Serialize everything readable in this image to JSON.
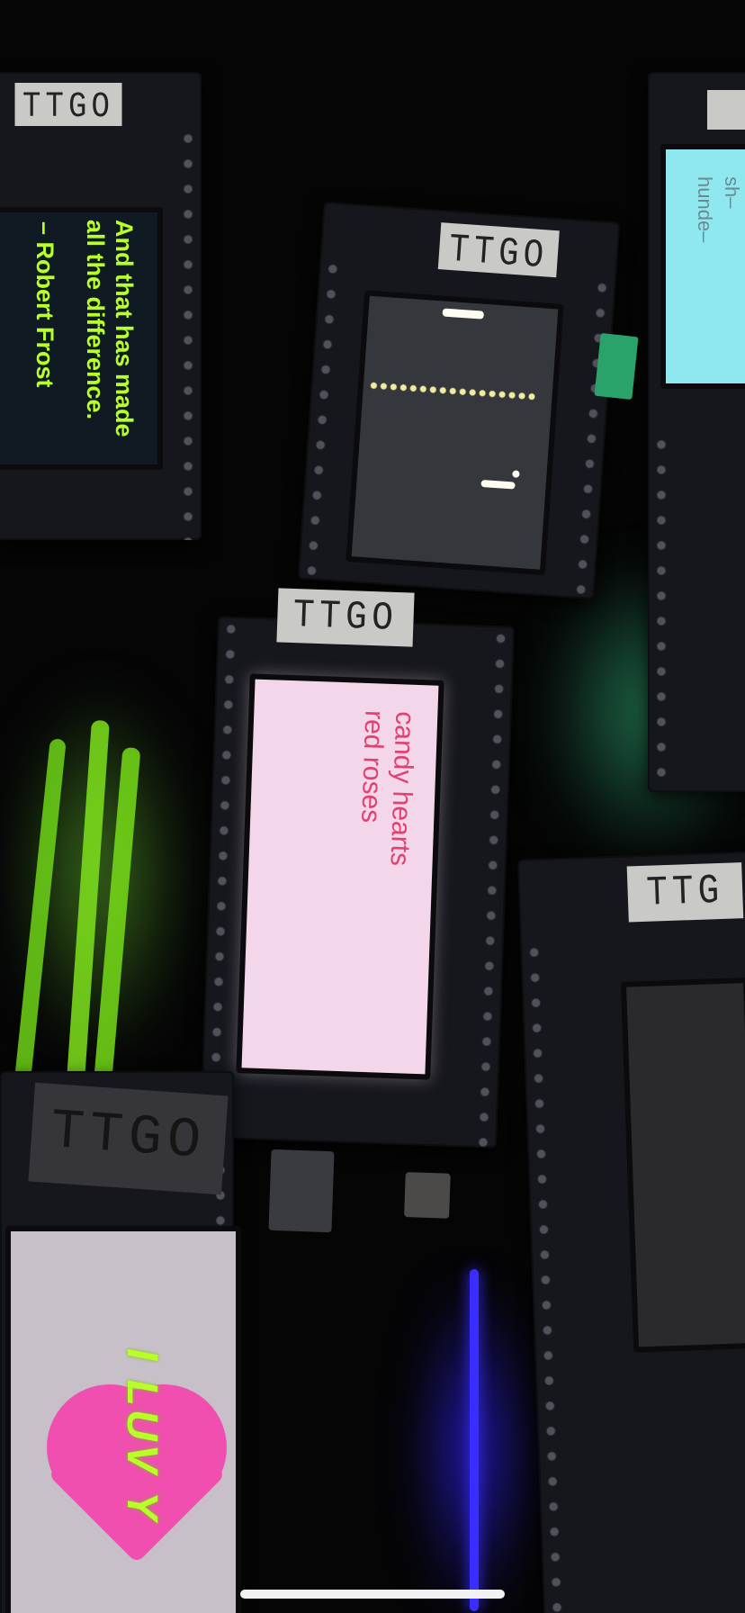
{
  "boards": {
    "top_left": {
      "label": "TTGO",
      "quote_line_1": "And that has made",
      "quote_line_2": "all the difference.",
      "attribution": "– Robert Frost"
    },
    "top_center": {
      "label": "TTGO"
    },
    "top_right": {
      "text_line_1": "sh–",
      "text_line_2": "hunde–"
    },
    "center": {
      "label": "TTGO",
      "line_1": "candy hearts",
      "line_2": "red roses"
    },
    "bottom_left": {
      "label": "TTGO",
      "screen_text": "I LUV Y"
    },
    "bottom_right": {
      "label": "TTG"
    }
  },
  "colors": {
    "green_text": "#b8ff2a",
    "pink_text": "#e2406e",
    "pink_screen": "#f4d6ea",
    "cyan_screen": "#8fe8f0",
    "heart": "#f04fb0"
  }
}
